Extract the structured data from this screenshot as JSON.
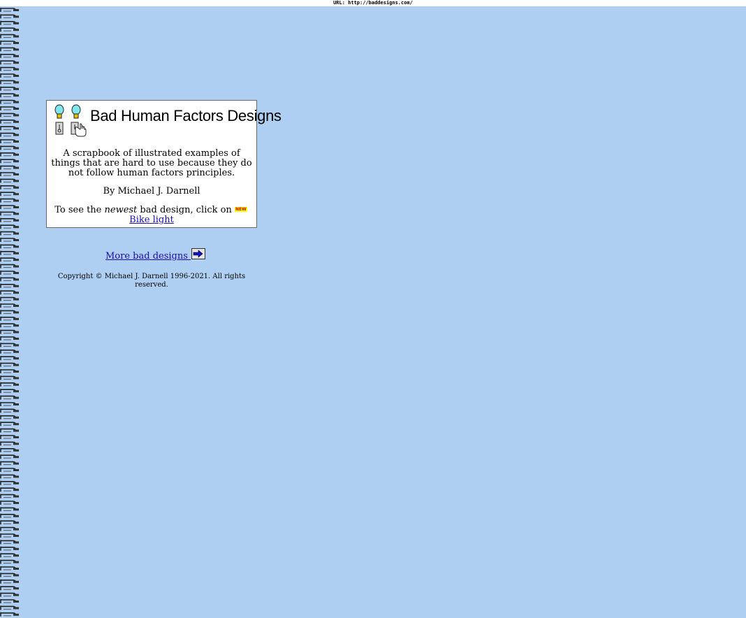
{
  "url_bar": {
    "text": "URL: http://baddesigns.com/"
  },
  "card": {
    "title": "Bad Human Factors Designs",
    "description": "A scrapbook of illustrated examples of things that are hard to use because they do not follow human factors principles.",
    "byline": "By Michael J. Darnell",
    "newest_prefix": "To see the ",
    "newest_emphasis": "newest",
    "newest_suffix": " bad design, click on ",
    "new_badge": "NEW",
    "newest_link": " Bike light"
  },
  "more_link": "More bad designs ",
  "copyright": "Copyright © Michael J. Darnell 1996-2021. All rights reserved.",
  "colors": {
    "background": "#aecff2",
    "link": "#1a0dab",
    "card_bg": "#ffffff",
    "bulb": "#7fe6ee",
    "bulb_base": "#e2c300"
  },
  "icons": [
    "spiral-binding",
    "lightbulb-icon",
    "switch-icon",
    "hand-pointer-icon",
    "right-arrow-icon"
  ]
}
